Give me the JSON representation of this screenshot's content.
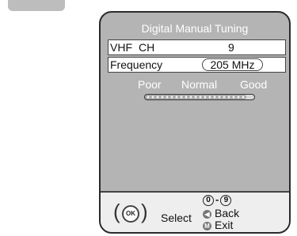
{
  "menu": {
    "title": "Digital Manual Tuning",
    "channel": {
      "band": "VHF",
      "label": "CH",
      "value": "9"
    },
    "frequency": {
      "label": "Frequency",
      "value": "205 MHz"
    },
    "signal": {
      "labels": [
        "Poor",
        "Normal",
        "Good"
      ],
      "level": 0.93
    }
  },
  "footer": {
    "ok_key": "OK",
    "select_label": "Select",
    "num_start": "0",
    "num_sep": "-",
    "num_end": "9",
    "back_label": "Back",
    "exit_key": "M",
    "exit_label": "Exit"
  },
  "icons": {
    "ok": "ok-button-icon",
    "back": "back-arrow-icon",
    "exit": "menu-m-icon"
  }
}
